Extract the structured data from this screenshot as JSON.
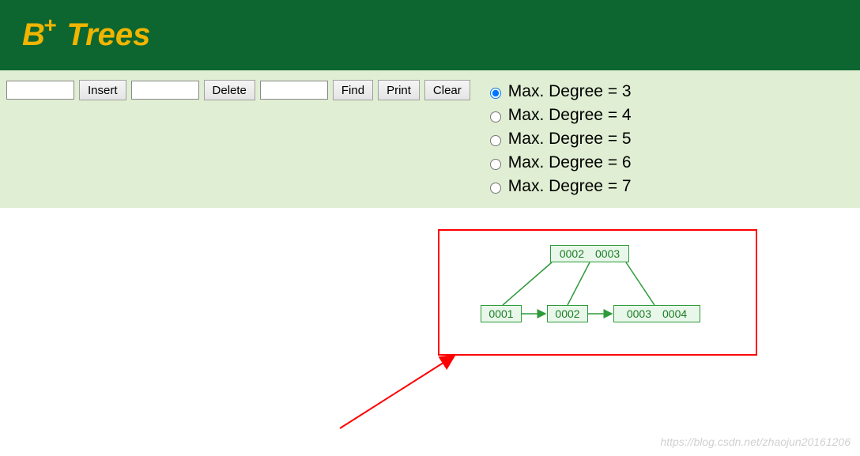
{
  "header": {
    "title_prefix": "B",
    "title_sup": "+",
    "title_suffix": " Trees"
  },
  "toolbar": {
    "insert_label": "Insert",
    "delete_label": "Delete",
    "find_label": "Find",
    "print_label": "Print",
    "clear_label": "Clear",
    "insert_value": "",
    "delete_value": "",
    "find_value": ""
  },
  "options": {
    "selected": 3,
    "items": [
      {
        "value": 3,
        "label": "Max. Degree = 3"
      },
      {
        "value": 4,
        "label": "Max. Degree = 4"
      },
      {
        "value": 5,
        "label": "Max. Degree = 5"
      },
      {
        "value": 6,
        "label": "Max. Degree = 6"
      },
      {
        "value": 7,
        "label": "Max. Degree = 7"
      }
    ]
  },
  "tree": {
    "root": {
      "keys": [
        "0002",
        "0003"
      ]
    },
    "leaves": [
      {
        "keys": [
          "0001"
        ]
      },
      {
        "keys": [
          "0002"
        ]
      },
      {
        "keys": [
          "0003",
          "0004"
        ]
      }
    ]
  },
  "watermark": "https://blog.csdn.net/zhaojun20161206"
}
